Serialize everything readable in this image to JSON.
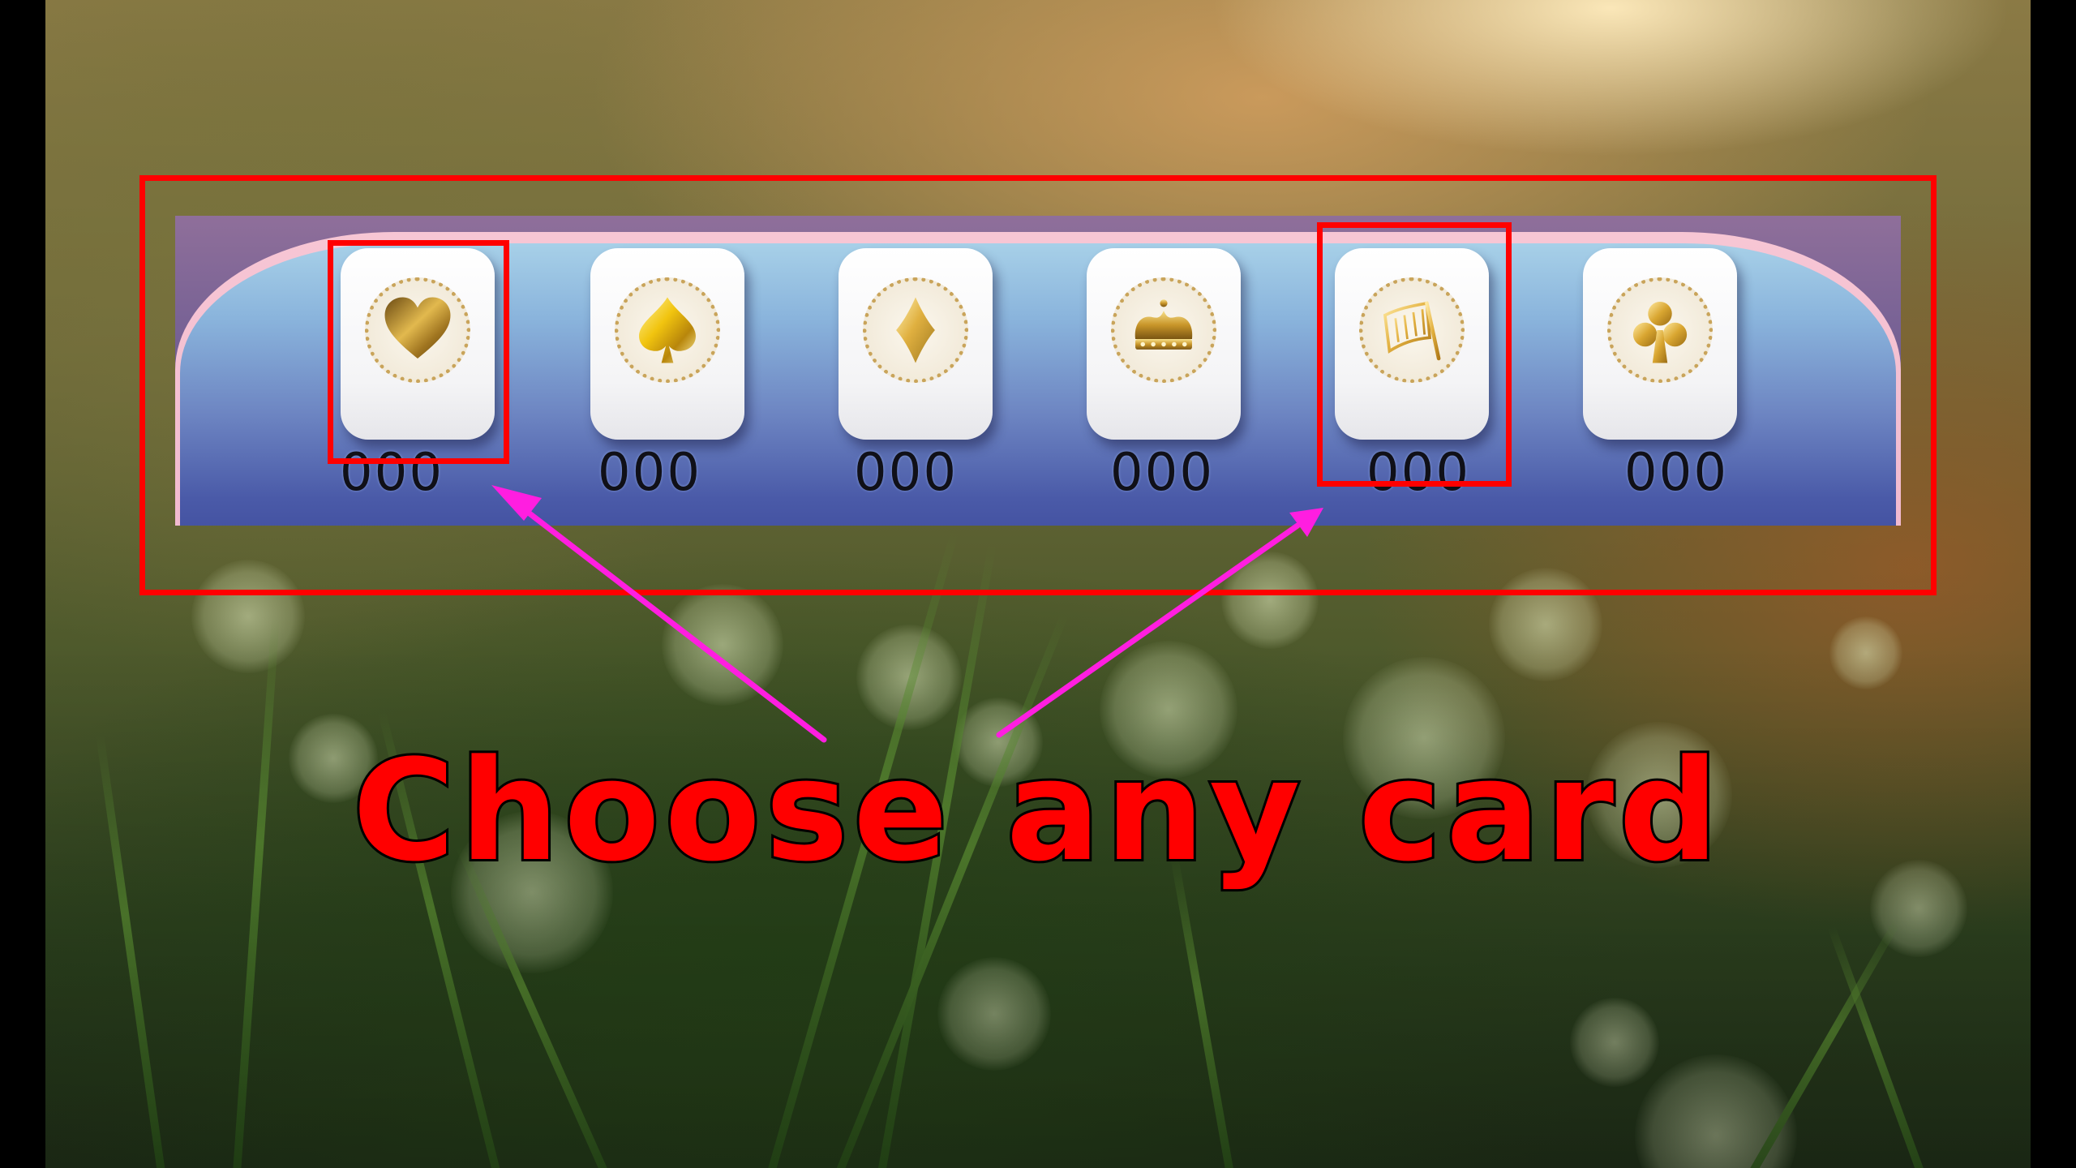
{
  "cards": [
    {
      "suit": "heart",
      "icon": "heart-icon",
      "count": "000"
    },
    {
      "suit": "spade",
      "icon": "spade-icon",
      "count": "000"
    },
    {
      "suit": "diamond",
      "icon": "diamond-icon",
      "count": "000"
    },
    {
      "suit": "crown",
      "icon": "crown-icon",
      "count": "000"
    },
    {
      "suit": "flag",
      "icon": "flag-icon",
      "count": "000"
    },
    {
      "suit": "club",
      "icon": "club-icon",
      "count": "000"
    }
  ],
  "caption": "Choose any card",
  "colors": {
    "highlight": "#ff0000",
    "arrow": "#ff1ee0",
    "gold": "#d4a520"
  }
}
